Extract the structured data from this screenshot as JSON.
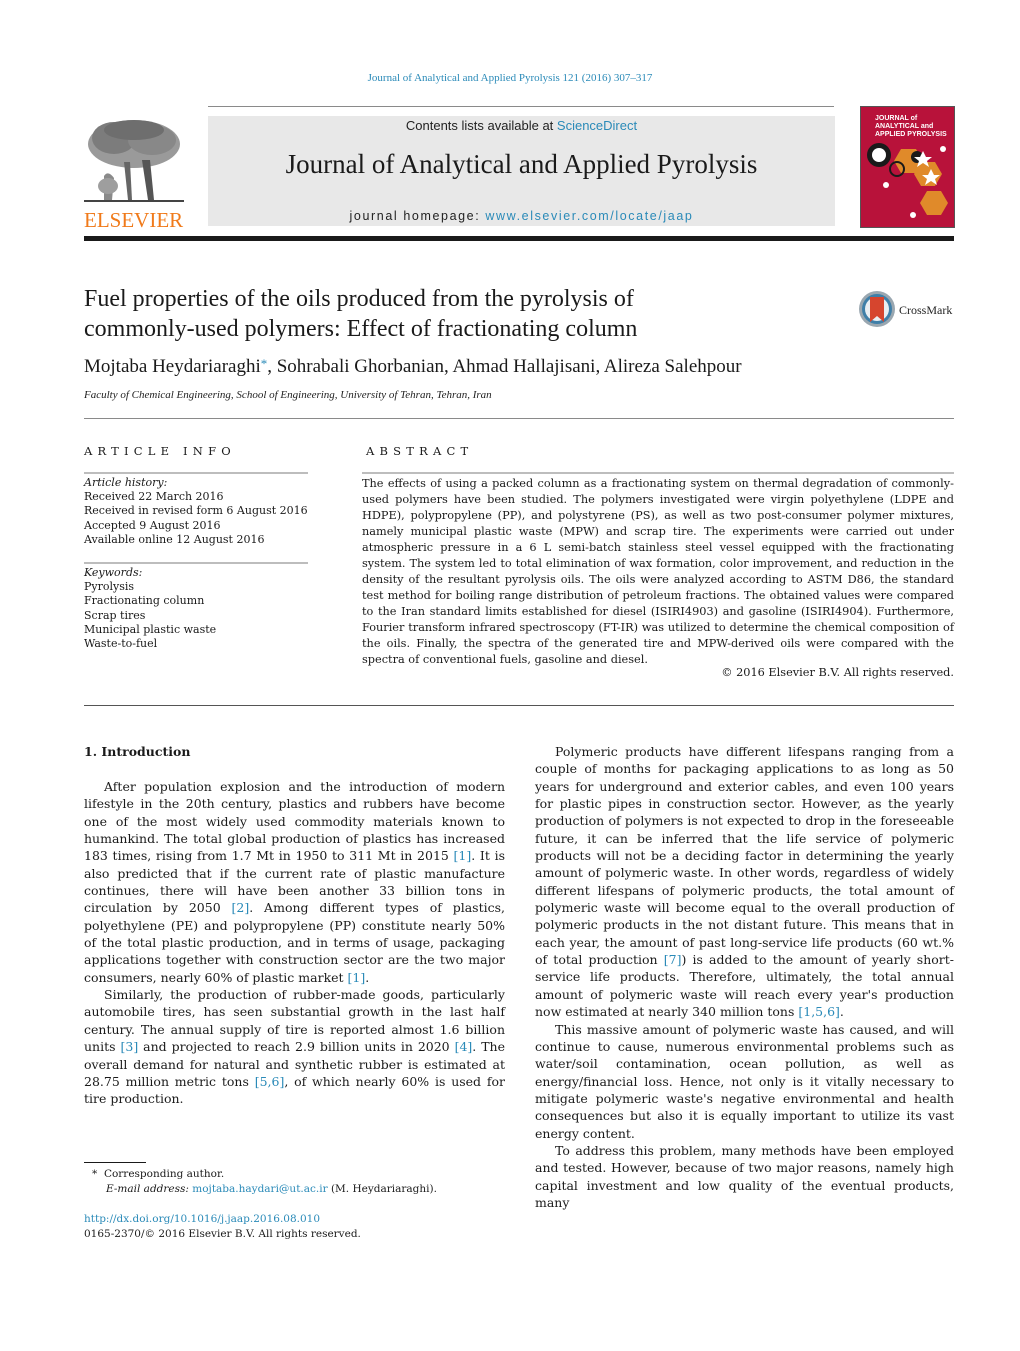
{
  "running_head": "Journal of Analytical and Applied Pyrolysis 121 (2016) 307–317",
  "masthead": {
    "publisher_logo_text": "ELSEVIER",
    "contents_prefix": "Contents lists available at ",
    "contents_link": "ScienceDirect",
    "journal_name": "Journal of Analytical and Applied Pyrolysis",
    "homepage_prefix": "journal homepage: ",
    "homepage_link": "www.elsevier.com/locate/jaap",
    "cover_title_lines": [
      "JOURNAL of",
      "ANALYTICAL and",
      "APPLIED PYROLYSIS"
    ],
    "colors": {
      "link": "#2a8ab8",
      "elsevier_orange": "#f07a1a",
      "cover_red": "#b8123a",
      "banner_gray": "#e8e8e8"
    }
  },
  "article": {
    "title_line1": "Fuel properties of the oils produced from the pyrolysis of",
    "title_line2": "commonly-used polymers: Effect of fractionating column",
    "crossmark_label": "CrossMark",
    "authors": {
      "first": "Mojtaba Heydariaraghi",
      "first_mark": "*",
      "rest": ", Sohrabali Ghorbanian, Ahmad Hallajisani, Alireza Salehpour"
    },
    "affiliation": "Faculty of Chemical Engineering, School of Engineering, University of Tehran, Tehran, Iran"
  },
  "article_info": {
    "heading": "ARTICLE INFO",
    "history_label": "Article history:",
    "history": [
      "Received 22 March 2016",
      "Received in revised form 6 August 2016",
      "Accepted 9 August 2016",
      "Available online 12 August 2016"
    ],
    "keywords_label": "Keywords:",
    "keywords": [
      "Pyrolysis",
      "Fractionating column",
      "Scrap tires",
      "Municipal plastic waste",
      "Waste-to-fuel"
    ]
  },
  "abstract": {
    "heading": "ABSTRACT",
    "text": "The effects of using a packed column as a fractionating system on thermal degradation of commonly-used polymers have been studied. The polymers investigated were virgin polyethylene (LDPE and HDPE), polypropylene (PP), and polystyrene (PS), as well as two post-consumer polymer mixtures, namely municipal plastic waste (MPW) and scrap tire. The experiments were carried out under atmospheric pressure in a 6 L semi-batch stainless steel vessel equipped with the fractionating system. The system led to total elimination of wax formation, color improvement, and reduction in the density of the resultant pyrolysis oils. The oils were analyzed according to ASTM D86, the standard test method for boiling range distribution of petroleum fractions. The obtained values were compared to the Iran standard limits established for diesel (ISIRI4903) and gasoline (ISIRI4904). Furthermore, Fourier transform infrared spectroscopy (FT-IR) was utilized to determine the chemical composition of the oils. Finally, the spectra of the generated tire and MPW-derived oils were compared with the spectra of conventional fuels, gasoline and diesel.",
    "copyright": "© 2016 Elsevier B.V. All rights reserved."
  },
  "introduction": {
    "heading": "1.  Introduction",
    "left_paragraphs": [
      {
        "parts": [
          {
            "t": "After population explosion and the introduction of modern lifestyle in the 20th century, plastics and rubbers have become one of the most widely used commodity materials known to humankind. The total global production of plastics has increased 183 times, rising from 1.7 Mt in 1950 to 311 Mt in 2015 "
          },
          {
            "ref": "[1]"
          },
          {
            "t": ". It is also predicted that if the current rate of plastic manufacture continues, there will have been another 33 billion tons in circulation by 2050 "
          },
          {
            "ref": "[2]"
          },
          {
            "t": ". Among different types of plastics, polyethylene (PE) and polypropylene (PP) constitute nearly 50% of the total plastic production, and in terms of usage, packaging applications together with construction sector are the two major consumers, nearly 60% of plastic market "
          },
          {
            "ref": "[1]"
          },
          {
            "t": "."
          }
        ]
      },
      {
        "parts": [
          {
            "t": "Similarly, the production of rubber-made goods, particularly automobile tires, has seen substantial growth in the last half century. The annual supply of tire is reported almost 1.6 billion units "
          },
          {
            "ref": "[3]"
          },
          {
            "t": " and projected to reach 2.9 billion units in 2020 "
          },
          {
            "ref": "[4]"
          },
          {
            "t": ". The overall demand for natural and synthetic rubber is estimated at 28.75 million metric tons "
          },
          {
            "ref": "[5,6]"
          },
          {
            "t": ", of which nearly 60% is used for tire production."
          }
        ]
      }
    ],
    "right_paragraphs": [
      {
        "parts": [
          {
            "t": "Polymeric products have different lifespans ranging from a couple of months for packaging applications to as long as 50 years for underground and exterior cables, and even 100 years for plastic pipes in construction sector. However, as the yearly production of polymers is not expected to drop in the foreseeable future, it can be inferred that the life service of polymeric products will not be a deciding factor in determining the yearly amount of polymeric waste. In other words, regardless of widely different lifespans of polymeric products, the total amount of polymeric waste will become equal to the overall production of polymeric products in the not distant future. This means that in each year, the amount of past long-service life products (60 wt.% of total production "
          },
          {
            "ref": "[7]"
          },
          {
            "t": ") is added to the amount of yearly short-service life products. Therefore, ultimately, the total annual amount of polymeric waste will reach every year's production now estimated at nearly 340 million tons "
          },
          {
            "ref": "[1,5,6]"
          },
          {
            "t": "."
          }
        ]
      },
      {
        "parts": [
          {
            "t": "This massive amount of polymeric waste has caused, and will continue to cause, numerous environmental problems such as water/soil contamination, ocean pollution, as well as energy/financial loss. Hence, not only is it vitally necessary to mitigate polymeric waste's negative environmental and health consequences but also it is equally important to utilize its vast energy content."
          }
        ]
      },
      {
        "parts": [
          {
            "t": "To address this problem, many methods have been employed and tested. However, because of two major reasons, namely high capital investment and low quality of the eventual products, many"
          }
        ]
      }
    ]
  },
  "footnote": {
    "mark": "*",
    "corresponding": "Corresponding author.",
    "email_label": "E-mail address: ",
    "email": "mojtaba.haydari@ut.ac.ir",
    "email_suffix": " (M. Heydariaraghi)."
  },
  "doi": {
    "url": "http://dx.doi.org/10.1016/j.jaap.2016.08.010",
    "issn_line": "0165-2370/© 2016 Elsevier B.V. All rights reserved."
  }
}
